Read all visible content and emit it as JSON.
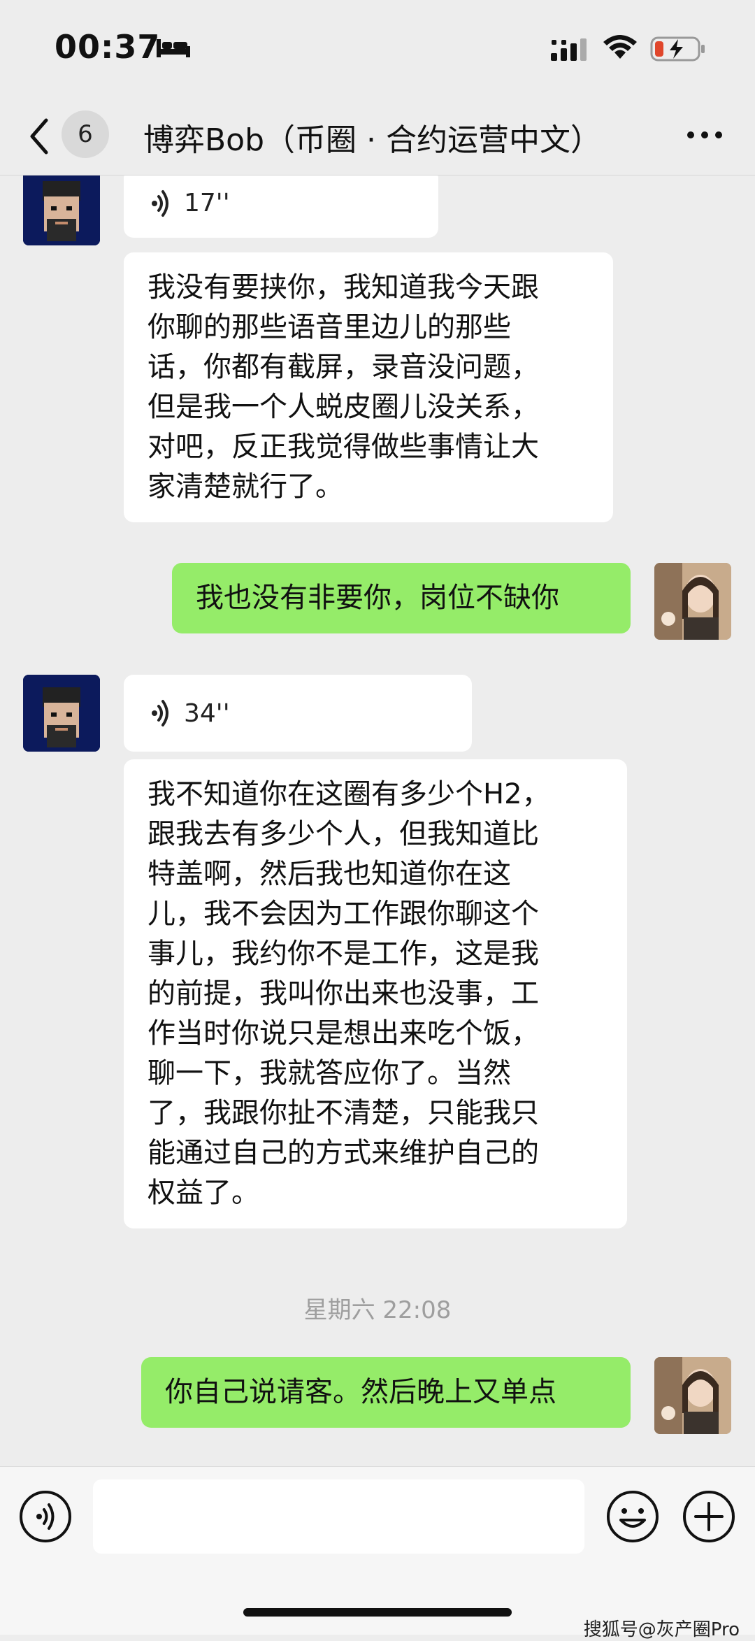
{
  "status_bar": {
    "time": "00:37",
    "icons": [
      "bed-icon",
      "cellular-signal-icon",
      "wifi-icon",
      "battery-charging-icon"
    ]
  },
  "header": {
    "back_icon": "chevron-left-icon",
    "unread_count": "6",
    "title": "博弈Bob（币圈 · 合约运营中文）",
    "more_icon": "more-dots-icon"
  },
  "messages": [
    {
      "side": "left",
      "type": "voice",
      "duration": "17''"
    },
    {
      "side": "left",
      "type": "text",
      "lines": [
        "我没有要挟你，我知道我今天跟",
        "你聊的那些语音里边儿的那些",
        "话，你都有截屏，录音没问题，",
        "但是我一个人蜕皮圈儿没关系，",
        "对吧，反正我觉得做些事情让大",
        "家清楚就行了。"
      ]
    },
    {
      "side": "right",
      "type": "text",
      "lines": [
        "我也没有非要你，岗位不缺你"
      ]
    },
    {
      "side": "left",
      "type": "voice",
      "duration": "34''"
    },
    {
      "side": "left",
      "type": "text",
      "lines": [
        "我不知道你在这圈有多少个H2，",
        "跟我去有多少个人，但我知道比",
        "特盖啊，然后我也知道你在这",
        "儿，我不会因为工作跟你聊这个",
        "事儿，我约你不是工作，这是我",
        "的前提，我叫你出来也没事，工",
        "作当时你说只是想出来吃个饭，",
        "聊一下，我就答应你了。当然",
        "了，我跟你扯不清楚，只能我只",
        "能通过自己的方式来维护自己的",
        "权益了。"
      ]
    },
    {
      "side": "center",
      "type": "timestamp",
      "text": "星期六 22:08"
    },
    {
      "side": "right",
      "type": "text",
      "lines": [
        "你自己说请客。然后晚上又单点"
      ]
    }
  ],
  "input_bar": {
    "value": "",
    "icons": [
      "voice-input-icon",
      "emoji-icon",
      "add-icon"
    ]
  },
  "watermark": "搜狐号@灰产圈Pro",
  "colors": {
    "background": "#ededed",
    "bubble_self": "#95ec69",
    "bubble_other": "#ffffff",
    "timestamp": "#9e9e9e"
  }
}
